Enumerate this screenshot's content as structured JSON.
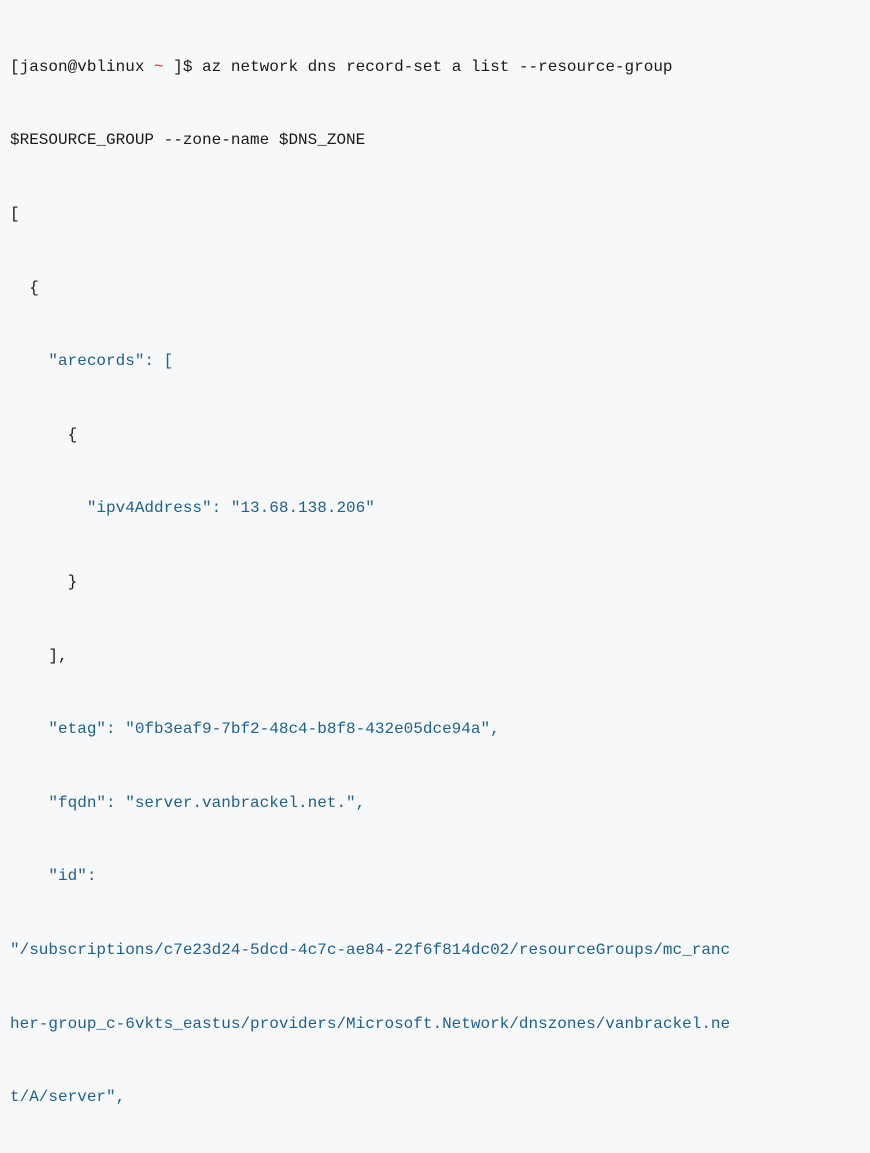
{
  "prompt": {
    "bracket_open": "[",
    "userhost": "jason@vblinux",
    "tilde": " ~ ",
    "bracket_close": "]$",
    "command_line1": " az network dns record-set a list --resource-group",
    "command_line2": "$RESOURCE_GROUP --zone-name $DNS_ZONE"
  },
  "output": {
    "l1": "[",
    "l2": "  {",
    "l3": "    \"arecords\": [",
    "l4": "      {",
    "l5": "        \"ipv4Address\": \"13.68.138.206\"",
    "l6": "      }",
    "l7": "    ],",
    "l8": "    \"etag\": \"0fb3eaf9-7bf2-48c4-b8f8-432e05dce94a\",",
    "l9": "    \"fqdn\": \"server.vanbrackel.net.\",",
    "l10": "    \"id\":",
    "l11a": "\"/subscriptions/c7e23d24-5dcd-4c7c-ae84-22f6f814dc02/resourceGroups/mc_ranc",
    "l11b": "her-group_c-6vkts_eastus/providers/Microsoft.Network/dnszones/vanbrackel.ne",
    "l11c": "t/A/server\","
  }
}
